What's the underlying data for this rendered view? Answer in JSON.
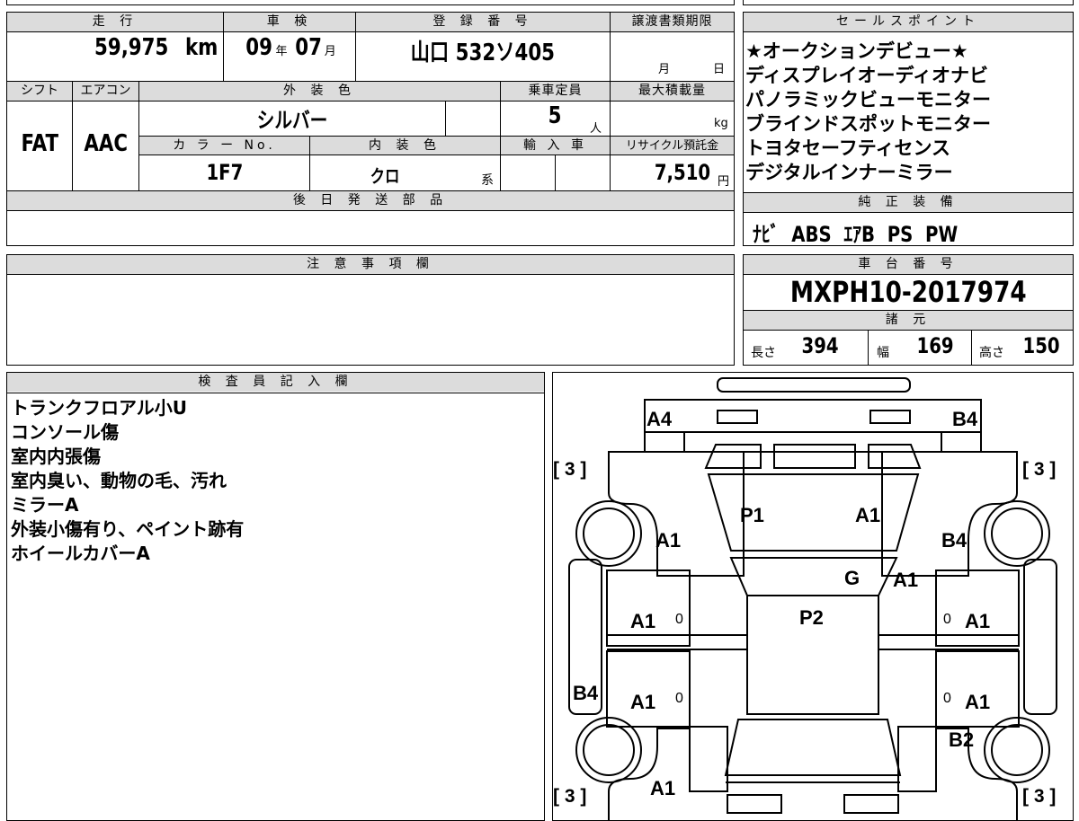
{
  "vehicle": {
    "mileage_header": "走 行",
    "mileage_value": "59,975",
    "mileage_unit": "km",
    "inspection_header": "車 検",
    "inspection_year": "09",
    "inspection_year_unit": "年",
    "inspection_month": "07",
    "inspection_month_unit": "月",
    "registration_header": "登 録 番 号",
    "registration_value": "山口 532ソ405",
    "transfer_deadline_header": "譲渡書類期限",
    "transfer_month_unit": "月",
    "transfer_day_unit": "日",
    "shift_header": "シフト",
    "shift_value": "FAT",
    "aircon_header": "エアコン",
    "aircon_value": "AAC",
    "exterior_color_header": "外 装 色",
    "exterior_color_value": "シルバー",
    "capacity_header": "乗車定員",
    "capacity_value": "5",
    "capacity_unit": "人",
    "max_load_header": "最大積載量",
    "max_load_unit": "kg",
    "color_no_header": "カ ラ ー No.",
    "color_no_value": "1F7",
    "interior_color_header": "内 装 色",
    "interior_color_value": "クロ",
    "interior_color_suffix": "系",
    "import_header": "輸 入 車",
    "recycle_header": "リサイクル預託金",
    "recycle_value": "7,510",
    "recycle_unit": "円",
    "later_parts_header": "後 日 発 送 部 品"
  },
  "sales_points": {
    "header": "セールスポイント",
    "items": [
      "★オークションデビュー★",
      "ディスプレイオーディオナビ",
      "パノラミックビューモニター",
      "ブラインドスポットモニター",
      "トヨタセーフティセンス",
      "デジタルインナーミラー"
    ]
  },
  "standard_equipment": {
    "header": "純 正 装 備",
    "value": "ﾅﾋﾞ  ABS  ｴｱB  PS  PW"
  },
  "notes": {
    "header": "注 意 事 項 欄"
  },
  "chassis": {
    "header": "車 台 番 号",
    "value": "MXPH10-2017974"
  },
  "specs": {
    "header": "諸 元",
    "length_label": "長さ",
    "length_value": "394",
    "width_label": "幅",
    "width_value": "169",
    "height_label": "高さ",
    "height_value": "150"
  },
  "inspector": {
    "header": "検 査 員 記 入 欄",
    "lines": [
      "トランクフロアル小U",
      "コンソール傷",
      "室内内張傷",
      "室内臭い、動物の毛、汚れ",
      "ミラーA",
      "外装小傷有り、ペイント跡有",
      "ホイールカバーA"
    ]
  },
  "diagram": {
    "tire_bracket_tl": "[ 3 ]",
    "tire_bracket_tr": "[ 3 ]",
    "tire_bracket_bl": "[ 3 ]",
    "tire_bracket_br": "[ 3 ]",
    "marks": {
      "a4": "A4",
      "b4_top": "B4",
      "p1": "P1",
      "a1_hood": "A1",
      "a1_left_fender": "A1",
      "b4_right_fender": "B4",
      "g": "G",
      "a1_right_pillar": "A1",
      "p2": "P2",
      "a1_left_front_door": "A1",
      "a1_right_front_door": "A1",
      "b4_left_rocker": "B4",
      "a1_left_rear_door": "A1",
      "a1_right_rear_door": "A1",
      "b2_right_rear": "B2",
      "a1_rear": "A1",
      "zero_lf": "0",
      "zero_rf": "0",
      "zero_lr": "0",
      "zero_rr": "0"
    }
  }
}
